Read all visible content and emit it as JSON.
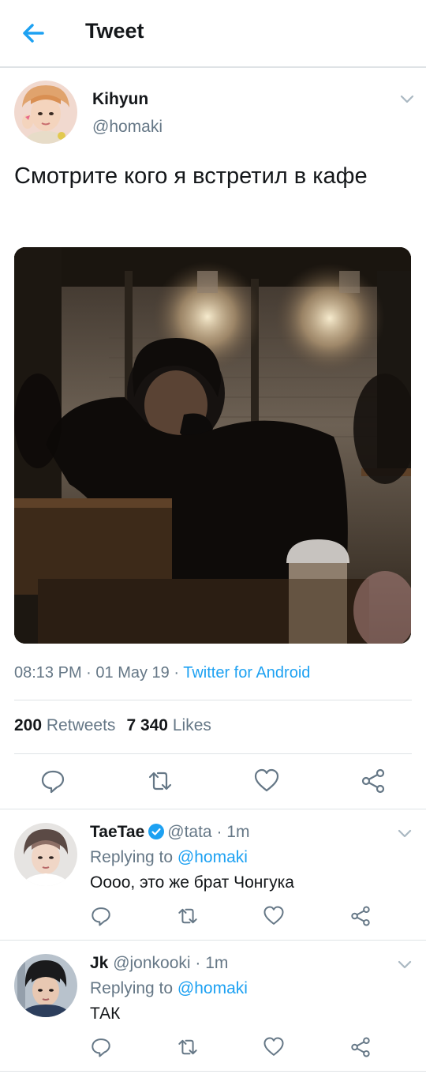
{
  "header": {
    "title": "Tweet",
    "back_icon": "arrow-left-icon",
    "accent_color": "#1da1f2"
  },
  "tweet": {
    "author_name": "Kihyun",
    "author_handle": "@homaki",
    "text": "Смотрите кого я встретил в кафе",
    "time": "08:13 PM",
    "date": "01 May 19",
    "separator": " · ",
    "source": "Twitter for Android",
    "retweets_count": "200",
    "retweets_label": "Retweets",
    "likes_count": "7 340",
    "likes_label": "Likes"
  },
  "actions": [
    "reply-icon",
    "retweet-icon",
    "like-icon",
    "share-icon"
  ],
  "replies": [
    {
      "name": "TaeTae",
      "verified": true,
      "handle": "@tata",
      "time": "1m",
      "replying_label": "Replying to",
      "replying_to": "@homaki",
      "text": "Оооо, это же брат Чонгука"
    },
    {
      "name": "Jk",
      "verified": false,
      "handle": "@jonkooki",
      "time": "1m",
      "replying_label": "Replying to",
      "replying_to": "@homaki",
      "text": "ТАК"
    }
  ]
}
